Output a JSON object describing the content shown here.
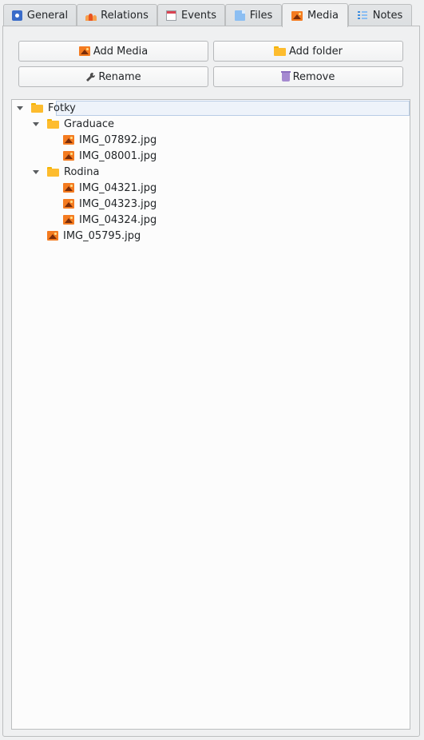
{
  "tabs": [
    {
      "label": "General",
      "icon": "gear-icon",
      "active": false
    },
    {
      "label": "Relations",
      "icon": "people-icon",
      "active": false
    },
    {
      "label": "Events",
      "icon": "calendar-icon",
      "active": false
    },
    {
      "label": "Files",
      "icon": "file-icon",
      "active": false
    },
    {
      "label": "Media",
      "icon": "image-icon",
      "active": true
    },
    {
      "label": "Notes",
      "icon": "list-icon",
      "active": false
    }
  ],
  "toolbar": {
    "add_media_label": "Add Media",
    "add_folder_label": "Add folder",
    "rename_label": "Rename",
    "remove_label": "Remove"
  },
  "tree": {
    "root": {
      "label": "Fotky",
      "type": "folder",
      "expanded": true,
      "selected": true
    },
    "folders": [
      {
        "label": "Graduace",
        "type": "folder",
        "expanded": true,
        "items": [
          "IMG_07892.jpg",
          "IMG_08001.jpg"
        ]
      },
      {
        "label": "Rodina",
        "type": "folder",
        "expanded": true,
        "items": [
          "IMG_04321.jpg",
          "IMG_04323.jpg",
          "IMG_04324.jpg"
        ]
      }
    ],
    "root_files": [
      "IMG_05795.jpg"
    ]
  },
  "colors": {
    "background": "#eff0f1",
    "folder": "#fdbc2e",
    "image": "#f47b20",
    "selection_border": "#b9cde6"
  }
}
